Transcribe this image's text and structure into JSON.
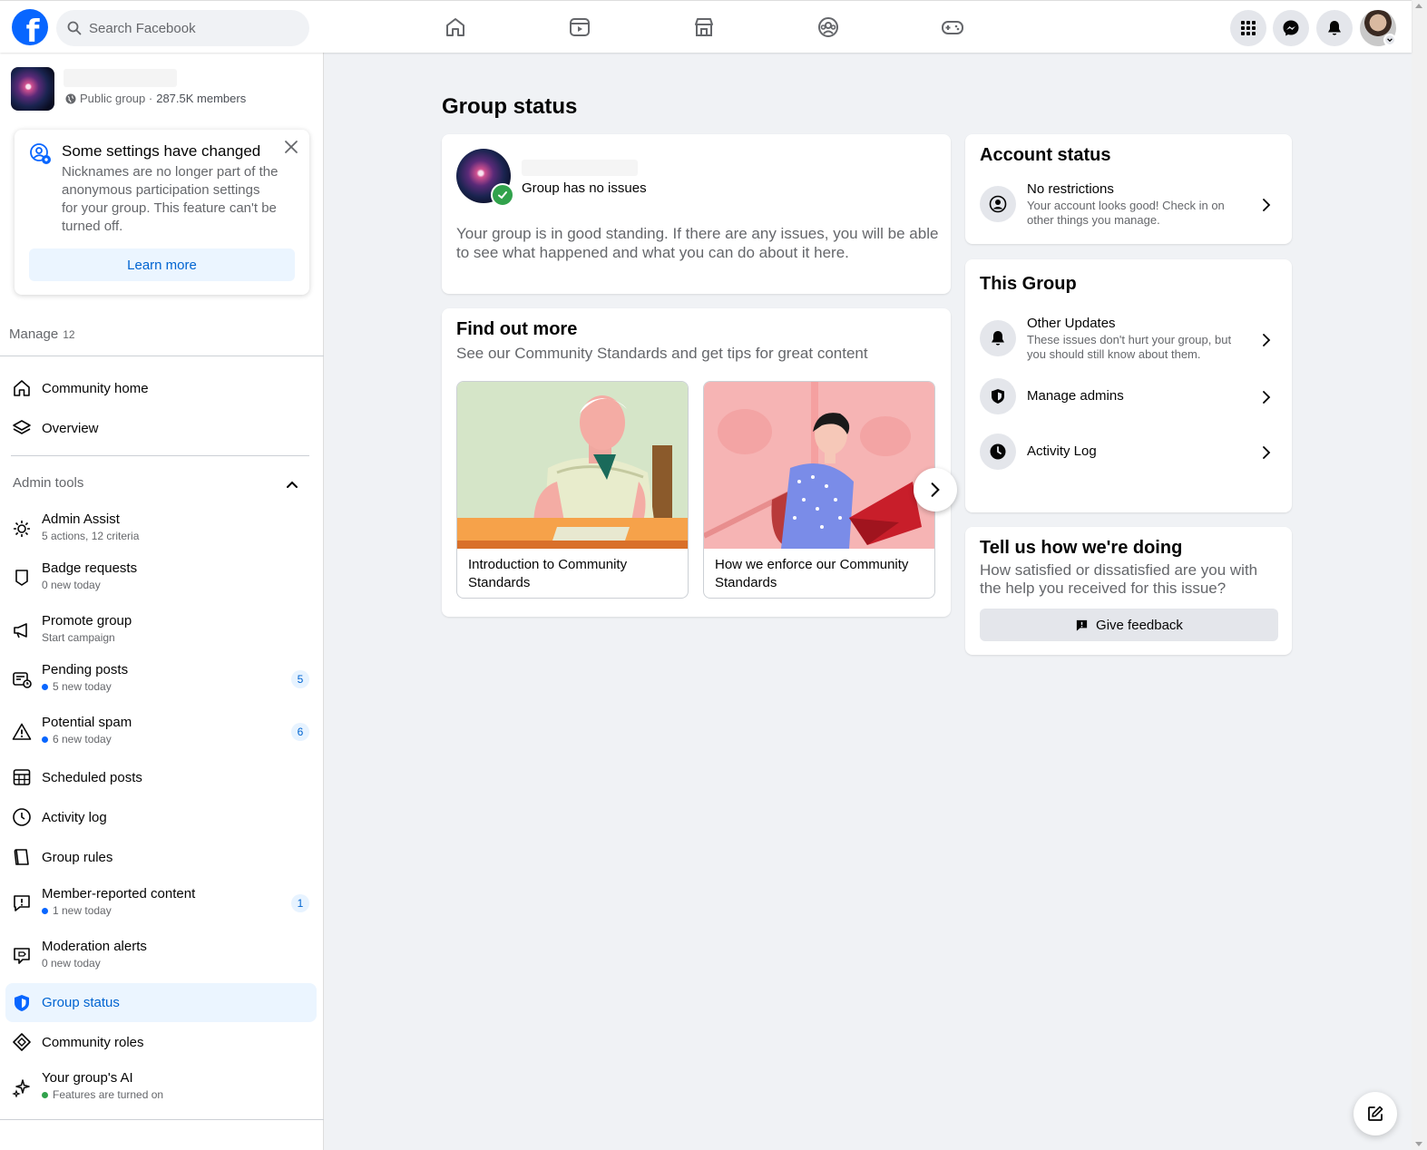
{
  "topbar": {
    "logo": "f",
    "search_placeholder": "Search Facebook",
    "nav_icons": [
      "home-icon",
      "video-icon",
      "marketplace-icon",
      "groups-icon",
      "gaming-icon"
    ],
    "right_icons": [
      "menu-grid-icon",
      "messenger-icon",
      "bell-icon"
    ]
  },
  "group": {
    "meta_prefix": "Public group · ",
    "members": "287.5K members"
  },
  "notice": {
    "title": "Some settings have changed",
    "body": "Nicknames are no longer part of the anonymous participation settings for your group. This feature can't be turned off.",
    "button": "Learn more"
  },
  "manage": {
    "label": "Manage",
    "count": "12"
  },
  "nav_top": [
    {
      "title": "Community home"
    },
    {
      "title": "Overview"
    }
  ],
  "admin_tools": {
    "label": "Admin tools"
  },
  "admin_items": [
    {
      "title": "Admin Assist",
      "sub": "5 actions, 12 criteria"
    },
    {
      "title": "Badge requests",
      "sub": "0 new today"
    },
    {
      "title": "Promote group",
      "sub": "Start campaign"
    },
    {
      "title": "Pending posts",
      "sub": "5 new today",
      "badge": "5"
    },
    {
      "title": "Potential spam",
      "sub": "6 new today",
      "badge": "6"
    },
    {
      "title": "Scheduled posts"
    },
    {
      "title": "Activity log"
    },
    {
      "title": "Group rules"
    },
    {
      "title": "Member-reported content",
      "sub": "1 new today",
      "badge": "1"
    },
    {
      "title": "Moderation alerts",
      "sub": "0 new today"
    },
    {
      "title": "Group status"
    },
    {
      "title": "Community roles"
    },
    {
      "title": "Your group's AI",
      "sub": "Features are turned on"
    }
  ],
  "main": {
    "title": "Group status",
    "status": {
      "label": "Group has no issues",
      "desc": "Your group is in good standing. If there are any issues, you will be able to see what happened and what you can do about it here."
    },
    "find_out": {
      "title": "Find out more",
      "sub": "See our Community Standards and get tips for great content",
      "articles": [
        {
          "caption": "Introduction to Community Standards"
        },
        {
          "caption": "How we enforce our Community Standards"
        }
      ]
    }
  },
  "account_status": {
    "title": "Account status",
    "row_title": "No restrictions",
    "row_sub": "Your account looks good! Check in on other things you manage."
  },
  "this_group": {
    "title": "This Group",
    "rows": [
      {
        "title": "Other Updates",
        "sub": "These issues don't hurt your group, but you should still know about them."
      },
      {
        "title": "Manage admins"
      },
      {
        "title": "Activity Log"
      }
    ]
  },
  "feedback": {
    "title": "Tell us how we're doing",
    "sub": "How satisfied or dissatisfied are you with the help you received for this issue?",
    "button": "Give feedback"
  },
  "colors": {
    "accent": "#0866ff",
    "link": "#0064d1",
    "success": "#31a24c"
  }
}
